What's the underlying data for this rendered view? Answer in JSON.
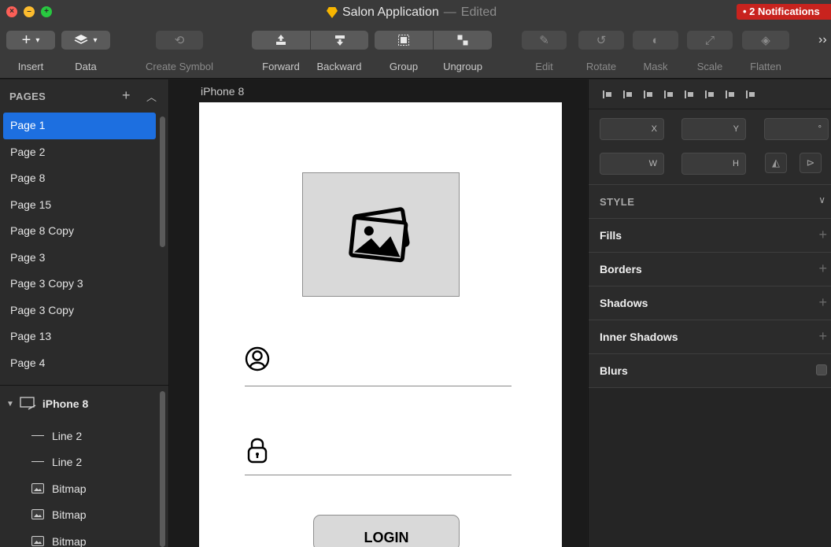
{
  "window": {
    "title": "Salon Application",
    "separator": "—",
    "status": "Edited",
    "notifications": "• 2 Notifications"
  },
  "toolbar": {
    "insert": "Insert",
    "data": "Data",
    "create_symbol": "Create Symbol",
    "forward": "Forward",
    "backward": "Backward",
    "group": "Group",
    "ungroup": "Ungroup",
    "edit": "Edit",
    "rotate": "Rotate",
    "mask": "Mask",
    "scale": "Scale",
    "flatten": "Flatten",
    "more": "››"
  },
  "sidebar": {
    "pages_title": "PAGES",
    "pages": [
      "Page 1",
      "Page 2",
      "Page 8",
      "Page 15",
      "Page 8 Copy",
      "Page 3",
      "Page 3 Copy 3",
      "Page 3 Copy",
      "Page 13",
      "Page 4"
    ],
    "active_page": "Page 1",
    "layer_group": "iPhone 8",
    "layers": [
      "Line 2",
      "Line 2",
      "Bitmap",
      "Bitmap",
      "Bitmap"
    ]
  },
  "canvas": {
    "artboard_name": "iPhone 8",
    "login_label": "LOGIN"
  },
  "inspector": {
    "x_label": "X",
    "y_label": "Y",
    "rotation_label": "°",
    "w_label": "W",
    "h_label": "H",
    "style_title": "STYLE",
    "fills": "Fills",
    "borders": "Borders",
    "shadows": "Shadows",
    "inner_shadows": "Inner Shadows",
    "blurs": "Blurs"
  }
}
